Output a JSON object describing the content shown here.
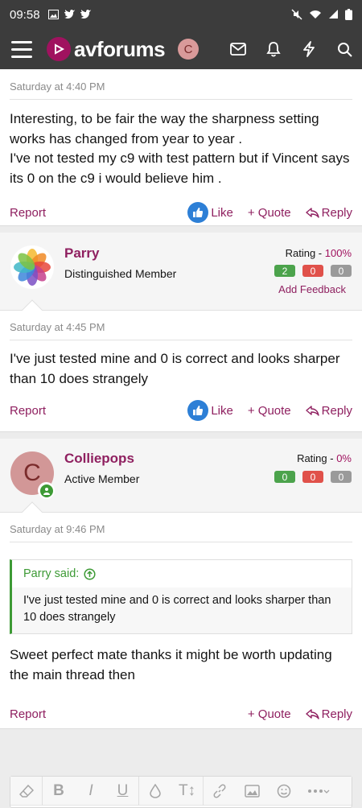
{
  "status": {
    "time": "09:58"
  },
  "nav": {
    "brand": "avforums",
    "avatar_letter": "C"
  },
  "colors": {
    "brand": "#a0125f",
    "link": "#8f2060",
    "navbar": "#3c3c3c",
    "like": "#2d7fd6",
    "quote": "#3d9a35"
  },
  "post1": {
    "time": "Saturday at 4:40 PM",
    "text1": "Interesting, to be fair the way the sharpness setting works has changed from year to year .",
    "text2": "I've not tested my c9 with test pattern but if Vincent says its 0 on the c9 i would believe him .",
    "report": "Report",
    "like": "Like",
    "quote": "+ Quote",
    "reply": "Reply"
  },
  "user2": {
    "name": "Parry",
    "title": "Distinguished Member",
    "rating_label": "Rating - ",
    "rating_pct": "100%",
    "pos": "2",
    "neg": "0",
    "neu": "0",
    "add_feedback": "Add Feedback"
  },
  "post2": {
    "time": "Saturday at 4:45 PM",
    "text": "I've just tested mine and 0 is correct and looks sharper than 10 does strangely",
    "report": "Report",
    "like": "Like",
    "quote": "+ Quote",
    "reply": "Reply"
  },
  "user3": {
    "name": "Colliepops",
    "title": "Active Member",
    "avatar_letter": "C",
    "rating_label": "Rating - ",
    "rating_pct": "0%",
    "pos": "0",
    "neg": "0",
    "neu": "0"
  },
  "post3": {
    "time": "Saturday at 9:46 PM",
    "quote_author": "Parry said:",
    "quote_text": "I've just tested mine and 0 is correct and looks sharper than 10 does strangely",
    "text": "Sweet perfect mate thanks it might be worth updating the main thread then",
    "report": "Report",
    "quote": "+ Quote",
    "reply": "Reply"
  },
  "editor": {
    "bold": "B",
    "italic": "I",
    "underline": "U",
    "text_size": "T↕"
  }
}
